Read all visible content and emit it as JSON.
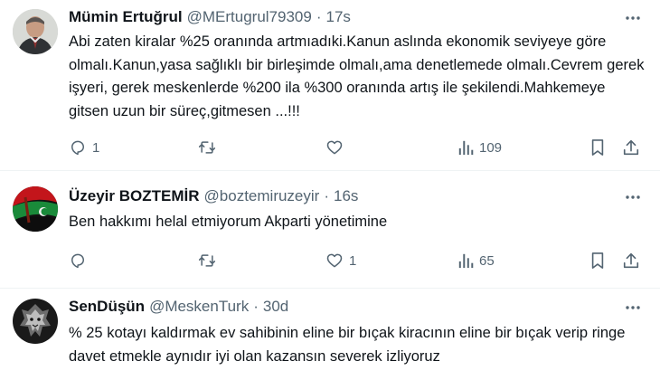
{
  "tweets": [
    {
      "name": "Mümin Ertuğrul",
      "handle": "@MErtugrul79309",
      "separator": "·",
      "time": "17s",
      "text": "Abi zaten kiralar %25 oranında artmıadıki.Kanun aslında ekonomik seviyeye göre olmalı.Kanun,yasa sağlıklı bir birleşimde olmalı,ama denetlemede olmalı.Cevrem gerek işyeri, gerek meskenlerde %200 ila %300 oranında artış ile şekilendi.Mahkemeye gitsen uzun bir süreç,gitmesen ...!!!",
      "reply_count": "1",
      "retweet_count": "",
      "like_count": "",
      "view_count": "109"
    },
    {
      "name": "Üzeyir BOZTEMİR",
      "handle": "@boztemiruzeyir",
      "separator": "·",
      "time": "16s",
      "text": "Ben hakkımı helal etmiyorum Akparti yönetimine",
      "reply_count": "",
      "retweet_count": "",
      "like_count": "1",
      "view_count": "65"
    },
    {
      "name": "SenDüşün",
      "handle": "@MeskenTurk",
      "separator": "·",
      "time": "30d",
      "text": "% 25 kotayı kaldırmak ev sahibinin eline bir bıçak kiracının eline bir bıçak verip ringe davet etmekle aynıdır iyi olan kazansın severek izliyoruz"
    }
  ],
  "colors": {
    "text_primary": "#0f1419",
    "text_secondary": "#536471",
    "divider": "#eff3f4"
  },
  "icons": [
    "more-icon",
    "reply-icon",
    "retweet-icon",
    "like-icon",
    "views-icon",
    "bookmark-icon",
    "share-icon"
  ]
}
